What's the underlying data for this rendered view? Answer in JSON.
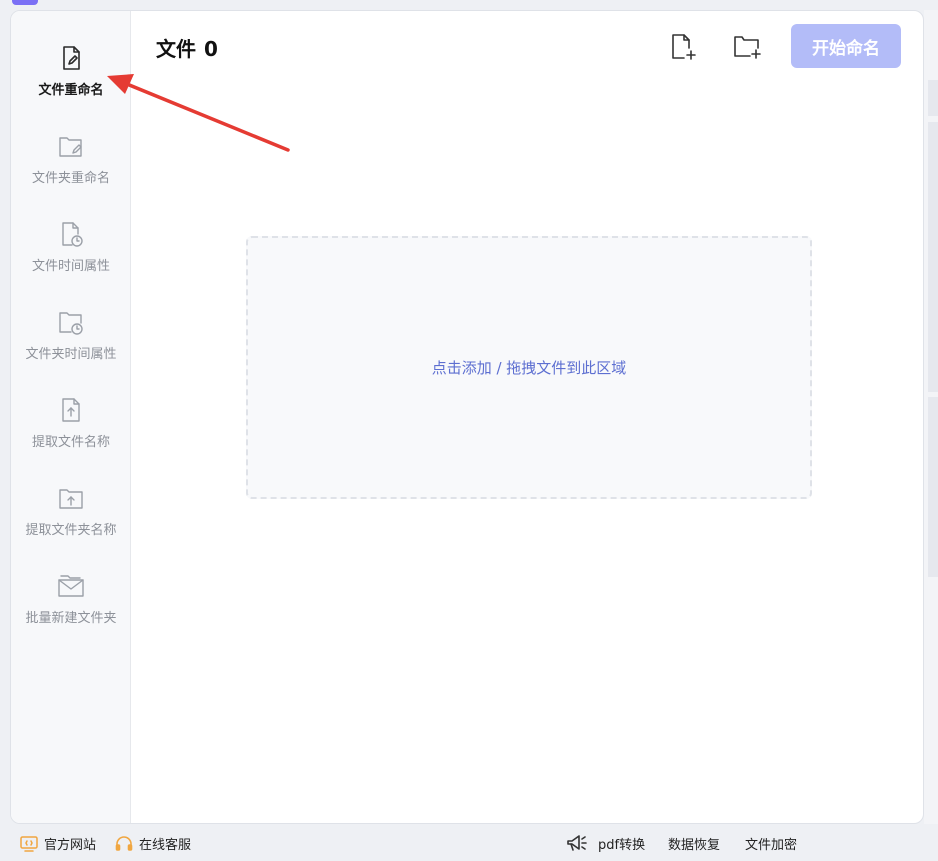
{
  "header": {
    "title": "文件",
    "count": "0",
    "start_button": "开始命名"
  },
  "sidebar": {
    "items": [
      {
        "label": "文件重命名",
        "icon": "file-edit-icon",
        "active": true
      },
      {
        "label": "文件夹重命名",
        "icon": "folder-edit-icon"
      },
      {
        "label": "文件时间属性",
        "icon": "file-clock-icon"
      },
      {
        "label": "文件夹时间属性",
        "icon": "folder-clock-icon"
      },
      {
        "label": "提取文件名称",
        "icon": "file-upload-icon"
      },
      {
        "label": "提取文件夹名称",
        "icon": "folder-upload-icon"
      },
      {
        "label": "批量新建文件夹",
        "icon": "folder-batch-icon"
      }
    ]
  },
  "toolbar": {
    "add_file_icon": "file-plus-icon",
    "add_folder_icon": "folder-plus-icon"
  },
  "dropzone": {
    "hint": "点击添加 / 拖拽文件到此区域"
  },
  "footer": {
    "official_site": "官方网站",
    "online_service": "在线客服",
    "pdf_convert": "pdf转换",
    "data_recovery": "数据恢复",
    "file_encrypt": "文件加密"
  },
  "colors": {
    "accent": "#b3bcf8",
    "hint": "#5d6fd1",
    "arrow": "#e53b33",
    "footer_icon": "#f0a640"
  }
}
